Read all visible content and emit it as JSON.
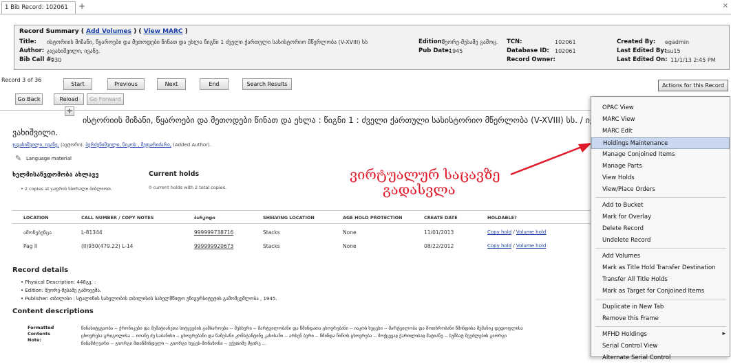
{
  "tab": {
    "label": "1 Bib Record: 102061",
    "add": "+",
    "close": "×"
  },
  "summary": {
    "heading": "Record Summary",
    "add_volumes": "Add Volumes",
    "view_marc": "View MARC",
    "paren_open": "(",
    "paren_mid": ") (",
    "paren_close": ")",
    "title_label": "Title:",
    "title_value": "ისტორიის მიზანი, წყაროები და მეთოდები წინათ და ეხლა წიგნი 1 ძველი ქართული სასისტორიო მწერლობა (V-XVIII) სს",
    "author_label": "Author:",
    "author_value": "ჯავახიშვილი, ივანე.",
    "callno_label": "Bib Call #:",
    "callno_value": "930",
    "edition_label": "Edition:",
    "edition_value": "მეორე-მესამე გამოც.",
    "pubdate_label": "Pub Date:",
    "pubdate_value": "1945",
    "tcn_label": "TCN:",
    "tcn_value": "102061",
    "dbid_label": "Database ID:",
    "dbid_value": "102061",
    "owner_label": "Record Owner:",
    "owner_value": "",
    "created_label": "Created By:",
    "created_value": "egadmin",
    "edited_label": "Last Edited By:",
    "edited_value": "tsu15",
    "editedon_label": "Last Edited On:",
    "editedon_value": "11/1/13 2:45 PM"
  },
  "nav": {
    "record_of": "Record 3 of 36",
    "start": "Start",
    "previous": "Previous",
    "next": "Next",
    "end": "End",
    "search_results": "Search Results",
    "actions": "Actions for this Record",
    "go_back": "Go Back",
    "reload": "Reload",
    "go_forward": "Go Forward"
  },
  "record": {
    "title": "ისტორიის მიზანი, წყაროები და მეთოდები წინათ და ეხლა : წიგნი 1 : ძველი ქართული სასისტორიო მწერლობა (V-XVIII) სს. / ივანე ჯა",
    "title_cont": "ვახიშვილი.",
    "author_link1": "ჯავახიშვილი, ივანე,",
    "author_role1": "(ავტორი).",
    "author_link2": "ბერძენიშვილი, ნიკოს , მეფარიძარი,",
    "author_role2": "(Added Author).",
    "format": "Language material",
    "availability_heading": "ხელმისაწვდომობა ახლავე",
    "availability_text": "• 2 copies at ჯაფრის სბირალი ბიბლიოთ.",
    "current_holds_heading": "Current holds",
    "current_holds_text": "0 current holds with 2 total copies."
  },
  "copies": {
    "headers": [
      "LOCATION",
      "CALL NUMBER / COPY NOTES",
      "ბარკოდი",
      "SHELVING LOCATION",
      "AGE HOLD PROTECTION",
      "CREATE DATE",
      "HOLDABLE?"
    ],
    "rows": [
      {
        "location": "ამონებენცა",
        "call": "L-81344",
        "barcode": "999999738716",
        "shelving": "Stacks",
        "age": "None",
        "date": "11/01/2013",
        "copy_hold": "Copy hold",
        "volume_hold": "Volume hold"
      },
      {
        "location": "Pag II",
        "call": "(II)930(479.22) L-14",
        "barcode": "999999920673",
        "shelving": "Stacks",
        "age": "None",
        "date": "08/22/2012",
        "copy_hold": "Copy hold",
        "volume_hold": "Volume hold"
      }
    ]
  },
  "details": {
    "heading": "Record details",
    "phys": "• Physical Description: 448გვ. :",
    "edition": "• Edition: მეორე-მესამე გამოცემა.",
    "publisher": "• Publisher: თბილისი : სტალინის სახელობის თბილისის სახელმწიფო უნივერსიტეტის გამომცემლობა , 1945.",
    "content_heading": "Content descriptions",
    "formatted_label": "Formatted Contents Note:",
    "contents_line1": "წინასიტყვაობა -- ქრონიკები და მემატიანეთა სიტყვების გამბაროება -- მესხური -- მარტვილობანი და წმინდათა ცხოვრებანი -- იაკობ ხუცესი -- მარტვილობა და მოთხრობანი წმინდისა შუშანიკ დედოფლისა",
    "contents_line2": "ცხოვრება გრიგოლისა -- იოანე ძე საბანისი -- ცხოვრებანი და წამებანი კონსტანტინე კახისანი -- არსენ ბერი -- წმინდა ნინოს ცხოვრება -- მოქცევაჲ ქართლისაჲ მატიანე -- სუმბატ შეუძლების გიორგი",
    "contents_line3": "წინამძღვარი -- გიორგი მთაწმინდელი -- გიორგი ხუცეს-მონაზონი -- ექვთიმე მცირე ..."
  },
  "annotation": {
    "line1": "ვირტუალურ საცავზე",
    "line2": "გადასვლა"
  },
  "menu": {
    "items": [
      {
        "label": "OPAC View",
        "highlight": false
      },
      {
        "label": "MARC View",
        "highlight": false
      },
      {
        "label": "MARC Edit",
        "highlight": false
      },
      {
        "label": "Holdings Maintenance",
        "highlight": true
      },
      {
        "label": "Manage Conjoined Items",
        "highlight": false
      },
      {
        "label": "Manage Parts",
        "highlight": false
      },
      {
        "label": "View Holds",
        "highlight": false
      },
      {
        "label": "View/Place Orders",
        "highlight": false
      },
      {
        "label": "Add to Bucket",
        "highlight": false
      },
      {
        "label": "Mark for Overlay",
        "highlight": false
      },
      {
        "label": "Delete Record",
        "highlight": false
      },
      {
        "label": "Undelete Record",
        "highlight": false
      },
      {
        "label": "Add Volumes",
        "highlight": false
      },
      {
        "label": "Mark as Title Hold Transfer Destination",
        "highlight": false
      },
      {
        "label": "Transfer All Title Holds",
        "highlight": false
      },
      {
        "label": "Mark as Target for Conjoined Items",
        "highlight": false
      },
      {
        "label": "Duplicate in New Tab",
        "highlight": false
      },
      {
        "label": "Remove this Frame",
        "highlight": false
      },
      {
        "label": "MFHD Holdings",
        "highlight": false
      },
      {
        "label": "Serial Control View",
        "highlight": false
      },
      {
        "label": "Alternate Serial Control",
        "highlight": false
      }
    ],
    "submenu_arrow": "▸"
  },
  "colors": {
    "link": "#1a3ea5",
    "annotation": "#e0192a",
    "highlight": "#c9d7f1"
  }
}
